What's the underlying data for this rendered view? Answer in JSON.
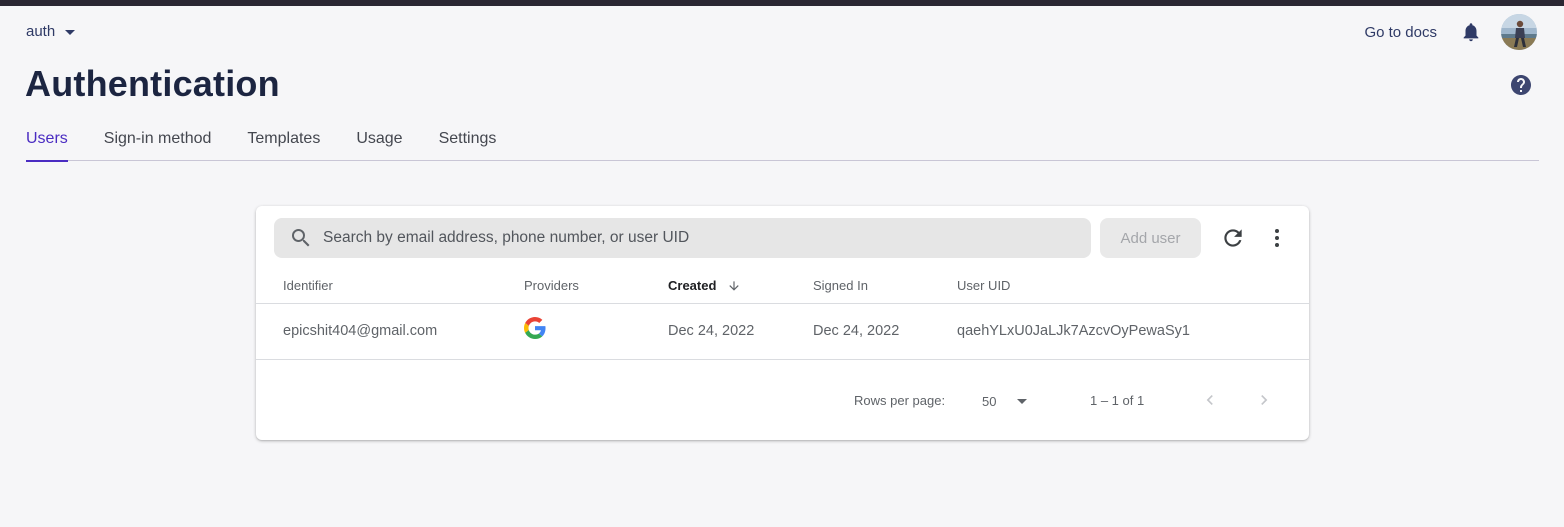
{
  "header": {
    "project_name": "auth",
    "docs_link": "Go to docs",
    "notification_icon": "bell-icon",
    "avatar_icon": "user-avatar",
    "help_icon": "help-circle-icon"
  },
  "page": {
    "title": "Authentication"
  },
  "tabs": [
    {
      "label": "Users",
      "active": true
    },
    {
      "label": "Sign-in method",
      "active": false
    },
    {
      "label": "Templates",
      "active": false
    },
    {
      "label": "Usage",
      "active": false
    },
    {
      "label": "Settings",
      "active": false
    }
  ],
  "toolbar": {
    "search_placeholder": "Search by email address, phone number, or user UID",
    "search_value": "",
    "add_user_label": "Add user",
    "refresh_icon": "refresh-icon",
    "more_icon": "more-vert-icon"
  },
  "table": {
    "columns": [
      "Identifier",
      "Providers",
      "Created",
      "Signed In",
      "User UID"
    ],
    "sorted_column": "Created",
    "sort_direction": "descending",
    "rows": [
      {
        "identifier": "epicshit404@gmail.com",
        "provider": "google-icon",
        "created": "Dec 24, 2022",
        "signed_in": "Dec 24, 2022",
        "uid": "qaehYLxU0JaLJk7AzcvOyPewaSy1"
      }
    ]
  },
  "pagination": {
    "rows_per_page_label": "Rows per page:",
    "rows_per_page_value": "50",
    "range_text": "1 – 1 of 1",
    "prev_icon": "chevron-left-icon",
    "next_icon": "chevron-right-icon"
  },
  "colors": {
    "accent": "#4a2cc2",
    "title": "#1c2541",
    "background": "#f6f6f8",
    "top_strip": "#2b2733"
  }
}
